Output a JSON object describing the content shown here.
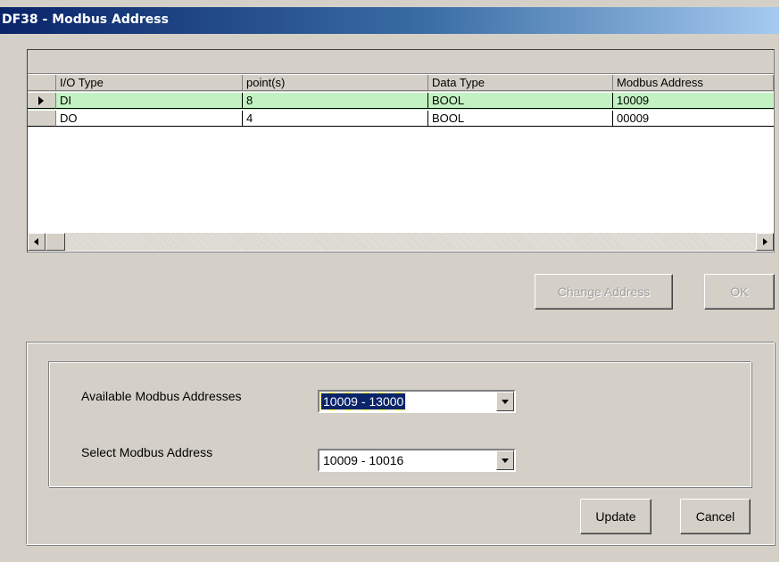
{
  "window": {
    "title": "DF38 - Modbus Address"
  },
  "grid": {
    "columns": [
      "I/O Type",
      "point(s)",
      "Data Type",
      "Modbus Address"
    ],
    "rows": [
      {
        "io_type": "DI",
        "points": "8",
        "data_type": "BOOL",
        "modbus_address": "10009"
      },
      {
        "io_type": "DO",
        "points": "4",
        "data_type": "BOOL",
        "modbus_address": "00009"
      }
    ],
    "selected_row_color": "#c2f2c2"
  },
  "buttons": {
    "change_address": "Change Address",
    "ok": "OK",
    "update": "Update",
    "cancel": "Cancel"
  },
  "form": {
    "available_label": "Available Modbus Addresses",
    "available_value": "10009 - 13000",
    "select_label": "Select Modbus Address",
    "select_value": "10009 - 10016"
  },
  "colors": {
    "title_gradient_start": "#0a246a",
    "dialog_background": "#d4d0c8",
    "selection_highlight": "#0a246a"
  }
}
